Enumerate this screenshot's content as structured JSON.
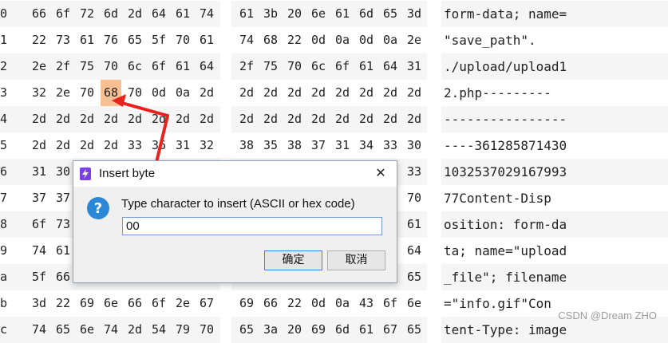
{
  "rows": [
    {
      "addr": "0",
      "hex": [
        "66",
        "6f",
        "72",
        "6d",
        "2d",
        "64",
        "61",
        "74",
        "61",
        "3b",
        "20",
        "6e",
        "61",
        "6d",
        "65",
        "3d"
      ],
      "ascii": "form-data; name="
    },
    {
      "addr": "1",
      "hex": [
        "22",
        "73",
        "61",
        "76",
        "65",
        "5f",
        "70",
        "61",
        "74",
        "68",
        "22",
        "0d",
        "0a",
        "0d",
        "0a",
        "2e"
      ],
      "ascii": "\"save_path\"."
    },
    {
      "addr": "2",
      "hex": [
        "2e",
        "2f",
        "75",
        "70",
        "6c",
        "6f",
        "61",
        "64",
        "2f",
        "75",
        "70",
        "6c",
        "6f",
        "61",
        "64",
        "31"
      ],
      "ascii": "./upload/upload1"
    },
    {
      "addr": "3",
      "hex": [
        "32",
        "2e",
        "70",
        "68",
        "70",
        "0d",
        "0a",
        "2d",
        "2d",
        "2d",
        "2d",
        "2d",
        "2d",
        "2d",
        "2d",
        "2d"
      ],
      "ascii": "2.php---------"
    },
    {
      "addr": "4",
      "hex": [
        "2d",
        "2d",
        "2d",
        "2d",
        "2d",
        "2d",
        "2d",
        "2d",
        "2d",
        "2d",
        "2d",
        "2d",
        "2d",
        "2d",
        "2d",
        "2d"
      ],
      "ascii": "----------------"
    },
    {
      "addr": "5",
      "hex": [
        "2d",
        "2d",
        "2d",
        "2d",
        "33",
        "36",
        "31",
        "32",
        "38",
        "35",
        "38",
        "37",
        "31",
        "34",
        "33",
        "30"
      ],
      "ascii": "----361285871430"
    },
    {
      "addr": "6",
      "hex": [
        "31",
        "30",
        "",
        "",
        "",
        "",
        "",
        "",
        "",
        "",
        "",
        "",
        "",
        "",
        "",
        "33"
      ],
      "ascii": "1032537029167993"
    },
    {
      "addr": "7",
      "hex": [
        "37",
        "37",
        "",
        "",
        "",
        "",
        "",
        "",
        "",
        "",
        "",
        "",
        "",
        "",
        "",
        "70"
      ],
      "ascii": "77Content-Disp"
    },
    {
      "addr": "8",
      "hex": [
        "6f",
        "73",
        "",
        "",
        "",
        "",
        "",
        "",
        "",
        "",
        "",
        "",
        "",
        "",
        "",
        "61"
      ],
      "ascii": "osition: form-da"
    },
    {
      "addr": "9",
      "hex": [
        "74",
        "61",
        "",
        "",
        "",
        "",
        "",
        "",
        "",
        "",
        "",
        "",
        "",
        "",
        "",
        "64"
      ],
      "ascii": "ta; name=\"upload"
    },
    {
      "addr": "a",
      "hex": [
        "5f",
        "66",
        "",
        "",
        "",
        "",
        "",
        "",
        "",
        "",
        "",
        "",
        "",
        "",
        "",
        "65"
      ],
      "ascii": "_file\"; filename"
    },
    {
      "addr": "b",
      "hex": [
        "3d",
        "22",
        "69",
        "6e",
        "66",
        "6f",
        "2e",
        "67",
        "69",
        "66",
        "22",
        "0d",
        "0a",
        "43",
        "6f",
        "6e"
      ],
      "ascii": "=\"info.gif\"Con"
    },
    {
      "addr": "c",
      "hex": [
        "74",
        "65",
        "6e",
        "74",
        "2d",
        "54",
        "79",
        "70",
        "65",
        "3a",
        "20",
        "69",
        "6d",
        "61",
        "67",
        "65"
      ],
      "ascii": "tent-Type: image"
    }
  ],
  "highlight": {
    "row": 3,
    "col": 3
  },
  "dialog": {
    "title": "Insert byte",
    "prompt": "Type character to insert (ASCII or hex code)",
    "input_value": "00",
    "ok_label": "确定",
    "cancel_label": "取消",
    "close_glyph": "✕",
    "icons": [
      "bolt-icon",
      "question-icon",
      "close-icon"
    ]
  },
  "watermark": "CSDN @Dream ZHO",
  "colors": {
    "highlight": "#f8bf92",
    "arrow": "#e8231e",
    "row_alt": "#f5f5f5",
    "question_icon": "#2b88d8",
    "title_icon": "#7b3fe4"
  }
}
